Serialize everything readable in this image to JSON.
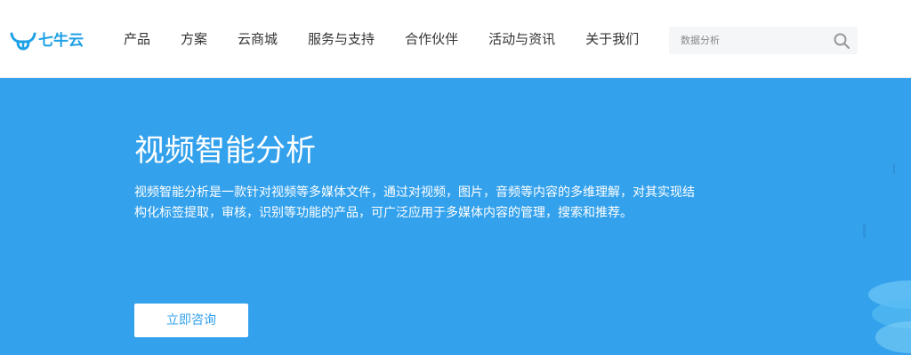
{
  "brand": {
    "name": "七牛云",
    "color": "#1ea0e6"
  },
  "nav": {
    "items": [
      {
        "label": "产品"
      },
      {
        "label": "方案"
      },
      {
        "label": "云商城"
      },
      {
        "label": "服务与支持"
      },
      {
        "label": "合作伙伴"
      },
      {
        "label": "活动与资讯"
      },
      {
        "label": "关于我们"
      }
    ]
  },
  "search": {
    "placeholder": "数据分析",
    "icon": "search-icon"
  },
  "hero": {
    "background": "#33a1ec",
    "title": "视频智能分析",
    "description": "视频智能分析是一款针对视频等多媒体文件，通过对视频，图片，音频等内容的多维理解，对其实现结构化标签提取，审核，识别等功能的产品，可广泛应用于多媒体内容的管理，搜索和推荐。",
    "cta_label": "立即咨询"
  }
}
